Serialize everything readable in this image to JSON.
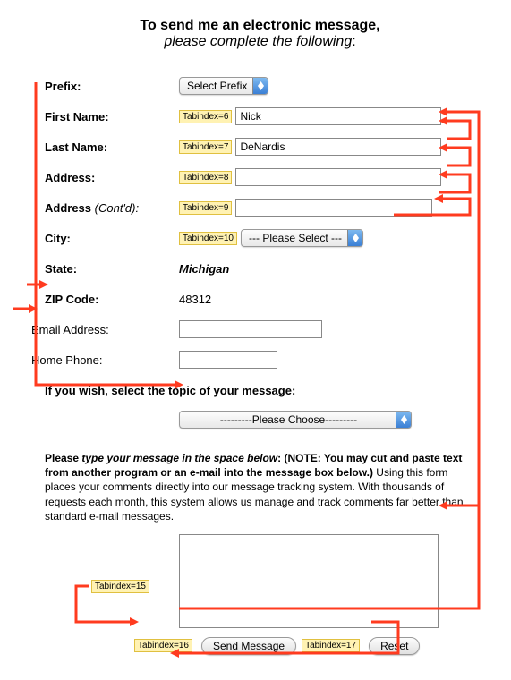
{
  "heading": {
    "line1": "To send me an electronic message,",
    "line2": "please complete the following",
    "colon": ":"
  },
  "labels": {
    "prefix": "Prefix:",
    "first_name": "First Name:",
    "last_name": "Last Name:",
    "address": "Address:",
    "address2_pre": "Address ",
    "address2_em": "(Cont'd):",
    "city": "City:",
    "state": "State:",
    "zip": "ZIP Code:",
    "email": "Email Address:",
    "phone": "Home Phone:"
  },
  "values": {
    "prefix_select": "Select Prefix",
    "first_name": "Nick",
    "last_name": "DeNardis",
    "address": "",
    "address2": "",
    "city_select": "--- Please Select ---",
    "state": "Michigan",
    "zip": "48312",
    "email": "",
    "phone": ""
  },
  "badges": {
    "t6": "Tabindex=6",
    "t7": "Tabindex=7",
    "t8": "Tabindex=8",
    "t9": "Tabindex=9",
    "t10": "Tabindex=10",
    "t15": "Tabindex=15",
    "t16": "Tabindex=16",
    "t17": "Tabindex=17"
  },
  "topic": {
    "title": "If you wish, select the topic of your message:",
    "select": "---------Please Choose---------"
  },
  "message": {
    "p1a": "Please ",
    "p1b": "type your message in the space below",
    "p1c": ": (NOTE:  You may cut and paste text from another program or an e-mail into the message box below.)",
    "p2": "Using this form places your comments directly into our message tracking system. With thousands of requests each month, this system allows us manage and track comments far better than standard e-mail messages."
  },
  "buttons": {
    "send": "Send Message",
    "reset": "Reset"
  }
}
